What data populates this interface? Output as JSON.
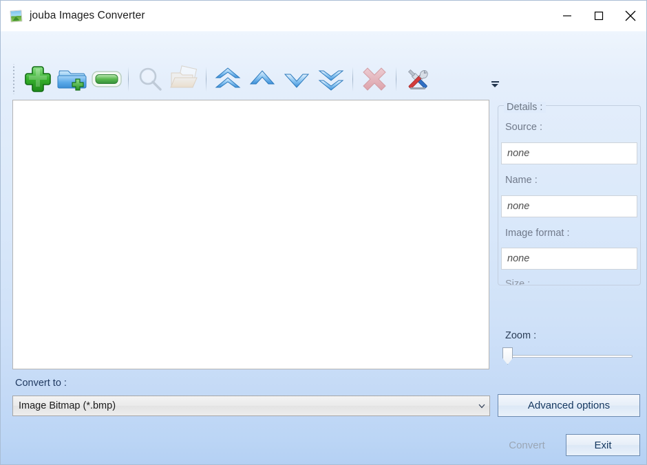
{
  "window": {
    "title": "jouba Images Converter",
    "app_icon": "picture-icon",
    "controls": {
      "minimize": "minimize-icon",
      "maximize": "maximize-icon",
      "close": "close-icon"
    }
  },
  "toolbar": {
    "grip": "drag-grip",
    "overflow": "toolbar-overflow-chevron",
    "buttons": [
      {
        "name": "add-file-button",
        "icon": "green-plus-icon",
        "disabled": false
      },
      {
        "name": "add-folder-button",
        "icon": "folder-add-icon",
        "disabled": false
      },
      {
        "name": "clear-list-button",
        "icon": "green-capsule-icon",
        "disabled": false
      },
      {
        "name": "preview-button",
        "icon": "magnifier-icon",
        "disabled": true
      },
      {
        "name": "open-folder-button",
        "icon": "open-folder-icon",
        "disabled": true
      },
      {
        "name": "move-top-button",
        "icon": "double-chevron-up-icon",
        "disabled": false
      },
      {
        "name": "move-up-button",
        "icon": "chevron-up-icon",
        "disabled": false
      },
      {
        "name": "move-down-button",
        "icon": "chevron-down-icon",
        "disabled": false
      },
      {
        "name": "move-bottom-button",
        "icon": "double-chevron-down-icon",
        "disabled": false
      },
      {
        "name": "remove-button",
        "icon": "red-x-icon",
        "disabled": true
      },
      {
        "name": "tools-button",
        "icon": "tools-icon",
        "disabled": false
      }
    ]
  },
  "file_list": {
    "items": []
  },
  "details": {
    "group_label": "Details :",
    "fields": [
      {
        "label": "Source :",
        "value": "none"
      },
      {
        "label": "Name :",
        "value": "none"
      },
      {
        "label": "Image format :",
        "value": "none"
      }
    ],
    "clipped_field_label": "Size :"
  },
  "zoom": {
    "label": "Zoom :",
    "value": 0
  },
  "convert": {
    "label": "Convert to :",
    "selected_format": "Image Bitmap (*.bmp)",
    "dropdown_arrow": "chevron-down-icon"
  },
  "actions": {
    "advanced_options": "Advanced options",
    "convert": "Convert",
    "exit": "Exit"
  }
}
